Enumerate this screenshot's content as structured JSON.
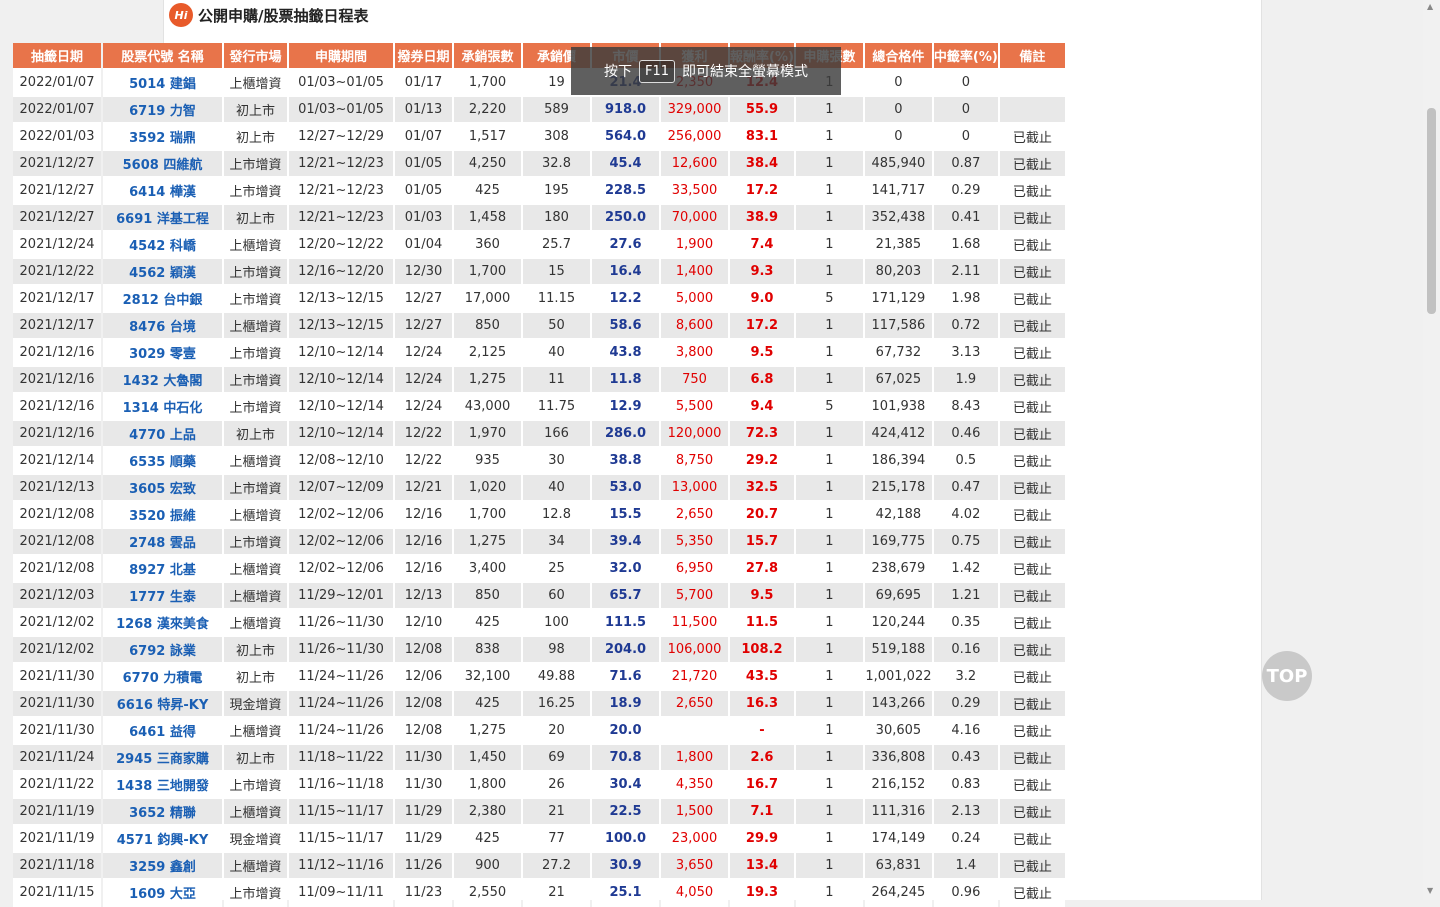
{
  "page": {
    "title": "公開申購/股票抽籤日程表",
    "logo_text": "Hi"
  },
  "fullscreen_notice": {
    "prefix": "按下",
    "key": "F11",
    "suffix": "即可結束全螢幕模式"
  },
  "top_button": "TOP",
  "table": {
    "headers": [
      "抽籤日期",
      "股票代號 名稱",
      "發行市場",
      "申購期間",
      "撥券日期",
      "承銷張數",
      "承銷價",
      "市價",
      "獲利",
      "報酬率(%)",
      "申購張數",
      "總合格件",
      "中籤率(%)",
      "備註"
    ],
    "rows": [
      [
        "2022/01/07",
        "5014 建錩",
        "上櫃增資",
        "01/03~01/05",
        "01/17",
        "1,700",
        "19",
        "21.4",
        "2,350",
        "12.4",
        "1",
        "0",
        "0",
        ""
      ],
      [
        "2022/01/07",
        "6719 力智",
        "初上市",
        "01/03~01/05",
        "01/13",
        "2,220",
        "589",
        "918.0",
        "329,000",
        "55.9",
        "1",
        "0",
        "0",
        ""
      ],
      [
        "2022/01/03",
        "3592 瑞鼎",
        "初上市",
        "12/27~12/29",
        "01/07",
        "1,517",
        "308",
        "564.0",
        "256,000",
        "83.1",
        "1",
        "0",
        "0",
        "已截止"
      ],
      [
        "2021/12/27",
        "5608 四維航",
        "上市增資",
        "12/21~12/23",
        "01/05",
        "4,250",
        "32.8",
        "45.4",
        "12,600",
        "38.4",
        "1",
        "485,940",
        "0.87",
        "已截止"
      ],
      [
        "2021/12/27",
        "6414 樺漢",
        "上市增資",
        "12/21~12/23",
        "01/05",
        "425",
        "195",
        "228.5",
        "33,500",
        "17.2",
        "1",
        "141,717",
        "0.29",
        "已截止"
      ],
      [
        "2021/12/27",
        "6691 洋基工程",
        "初上市",
        "12/21~12/23",
        "01/03",
        "1,458",
        "180",
        "250.0",
        "70,000",
        "38.9",
        "1",
        "352,438",
        "0.41",
        "已截止"
      ],
      [
        "2021/12/24",
        "4542 科嶠",
        "上櫃增資",
        "12/20~12/22",
        "01/04",
        "360",
        "25.7",
        "27.6",
        "1,900",
        "7.4",
        "1",
        "21,385",
        "1.68",
        "已截止"
      ],
      [
        "2021/12/22",
        "4562 穎漢",
        "上市增資",
        "12/16~12/20",
        "12/30",
        "1,700",
        "15",
        "16.4",
        "1,400",
        "9.3",
        "1",
        "80,203",
        "2.11",
        "已截止"
      ],
      [
        "2021/12/17",
        "2812 台中銀",
        "上市增資",
        "12/13~12/15",
        "12/27",
        "17,000",
        "11.15",
        "12.2",
        "5,000",
        "9.0",
        "5",
        "171,129",
        "1.98",
        "已截止"
      ],
      [
        "2021/12/17",
        "8476 台境",
        "上櫃增資",
        "12/13~12/15",
        "12/27",
        "850",
        "50",
        "58.6",
        "8,600",
        "17.2",
        "1",
        "117,586",
        "0.72",
        "已截止"
      ],
      [
        "2021/12/16",
        "3029 零壹",
        "上市增資",
        "12/10~12/14",
        "12/24",
        "2,125",
        "40",
        "43.8",
        "3,800",
        "9.5",
        "1",
        "67,732",
        "3.13",
        "已截止"
      ],
      [
        "2021/12/16",
        "1432 大魯閣",
        "上市增資",
        "12/10~12/14",
        "12/24",
        "1,275",
        "11",
        "11.8",
        "750",
        "6.8",
        "1",
        "67,025",
        "1.9",
        "已截止"
      ],
      [
        "2021/12/16",
        "1314 中石化",
        "上市增資",
        "12/10~12/14",
        "12/24",
        "43,000",
        "11.75",
        "12.9",
        "5,500",
        "9.4",
        "5",
        "101,938",
        "8.43",
        "已截止"
      ],
      [
        "2021/12/16",
        "4770 上品",
        "初上市",
        "12/10~12/14",
        "12/22",
        "1,970",
        "166",
        "286.0",
        "120,000",
        "72.3",
        "1",
        "424,412",
        "0.46",
        "已截止"
      ],
      [
        "2021/12/14",
        "6535 順藥",
        "上櫃增資",
        "12/08~12/10",
        "12/22",
        "935",
        "30",
        "38.8",
        "8,750",
        "29.2",
        "1",
        "186,394",
        "0.5",
        "已截止"
      ],
      [
        "2021/12/13",
        "3605 宏致",
        "上市增資",
        "12/07~12/09",
        "12/21",
        "1,020",
        "40",
        "53.0",
        "13,000",
        "32.5",
        "1",
        "215,178",
        "0.47",
        "已截止"
      ],
      [
        "2021/12/08",
        "3520 振維",
        "上櫃增資",
        "12/02~12/06",
        "12/16",
        "1,700",
        "12.8",
        "15.5",
        "2,650",
        "20.7",
        "1",
        "42,188",
        "4.02",
        "已截止"
      ],
      [
        "2021/12/08",
        "2748 雲品",
        "上市增資",
        "12/02~12/06",
        "12/16",
        "1,275",
        "34",
        "39.4",
        "5,350",
        "15.7",
        "1",
        "169,775",
        "0.75",
        "已截止"
      ],
      [
        "2021/12/08",
        "8927 北基",
        "上櫃增資",
        "12/02~12/06",
        "12/16",
        "3,400",
        "25",
        "32.0",
        "6,950",
        "27.8",
        "1",
        "238,679",
        "1.42",
        "已截止"
      ],
      [
        "2021/12/03",
        "1777 生泰",
        "上櫃增資",
        "11/29~12/01",
        "12/13",
        "850",
        "60",
        "65.7",
        "5,700",
        "9.5",
        "1",
        "69,695",
        "1.21",
        "已截止"
      ],
      [
        "2021/12/02",
        "1268 漢來美食",
        "上櫃增資",
        "11/26~11/30",
        "12/10",
        "425",
        "100",
        "111.5",
        "11,500",
        "11.5",
        "1",
        "120,244",
        "0.35",
        "已截止"
      ],
      [
        "2021/12/02",
        "6792 詠業",
        "初上市",
        "11/26~11/30",
        "12/08",
        "838",
        "98",
        "204.0",
        "106,000",
        "108.2",
        "1",
        "519,188",
        "0.16",
        "已截止"
      ],
      [
        "2021/11/30",
        "6770 力積電",
        "初上市",
        "11/24~11/26",
        "12/06",
        "32,100",
        "49.88",
        "71.6",
        "21,720",
        "43.5",
        "1",
        "1,001,022",
        "3.2",
        "已截止"
      ],
      [
        "2021/11/30",
        "6616 特昇-KY",
        "現金增資",
        "11/24~11/26",
        "12/08",
        "425",
        "16.25",
        "18.9",
        "2,650",
        "16.3",
        "1",
        "143,266",
        "0.29",
        "已截止"
      ],
      [
        "2021/11/30",
        "6461 益得",
        "上櫃增資",
        "11/24~11/26",
        "12/08",
        "1,275",
        "20",
        "20.0",
        "",
        "-",
        "1",
        "30,605",
        "4.16",
        "已截止"
      ],
      [
        "2021/11/24",
        "2945 三商家購",
        "初上市",
        "11/18~11/22",
        "11/30",
        "1,450",
        "69",
        "70.8",
        "1,800",
        "2.6",
        "1",
        "336,808",
        "0.43",
        "已截止"
      ],
      [
        "2021/11/22",
        "1438 三地開發",
        "上市增資",
        "11/16~11/18",
        "11/30",
        "1,800",
        "26",
        "30.4",
        "4,350",
        "16.7",
        "1",
        "216,152",
        "0.83",
        "已截止"
      ],
      [
        "2021/11/19",
        "3652 精聯",
        "上櫃增資",
        "11/15~11/17",
        "11/29",
        "2,380",
        "21",
        "22.5",
        "1,500",
        "7.1",
        "1",
        "111,316",
        "2.13",
        "已截止"
      ],
      [
        "2021/11/19",
        "4571 鈞興-KY",
        "現金增資",
        "11/15~11/17",
        "11/29",
        "425",
        "77",
        "100.0",
        "23,000",
        "29.9",
        "1",
        "174,149",
        "0.24",
        "已截止"
      ],
      [
        "2021/11/18",
        "3259 鑫創",
        "上櫃增資",
        "11/12~11/16",
        "11/26",
        "900",
        "27.2",
        "30.9",
        "3,650",
        "13.4",
        "1",
        "63,831",
        "1.4",
        "已截止"
      ],
      [
        "2021/11/15",
        "1609 大亞",
        "上市增資",
        "11/09~11/11",
        "11/23",
        "2,550",
        "21",
        "25.1",
        "4,050",
        "19.3",
        "1",
        "264,245",
        "0.96",
        "已截止"
      ]
    ]
  }
}
